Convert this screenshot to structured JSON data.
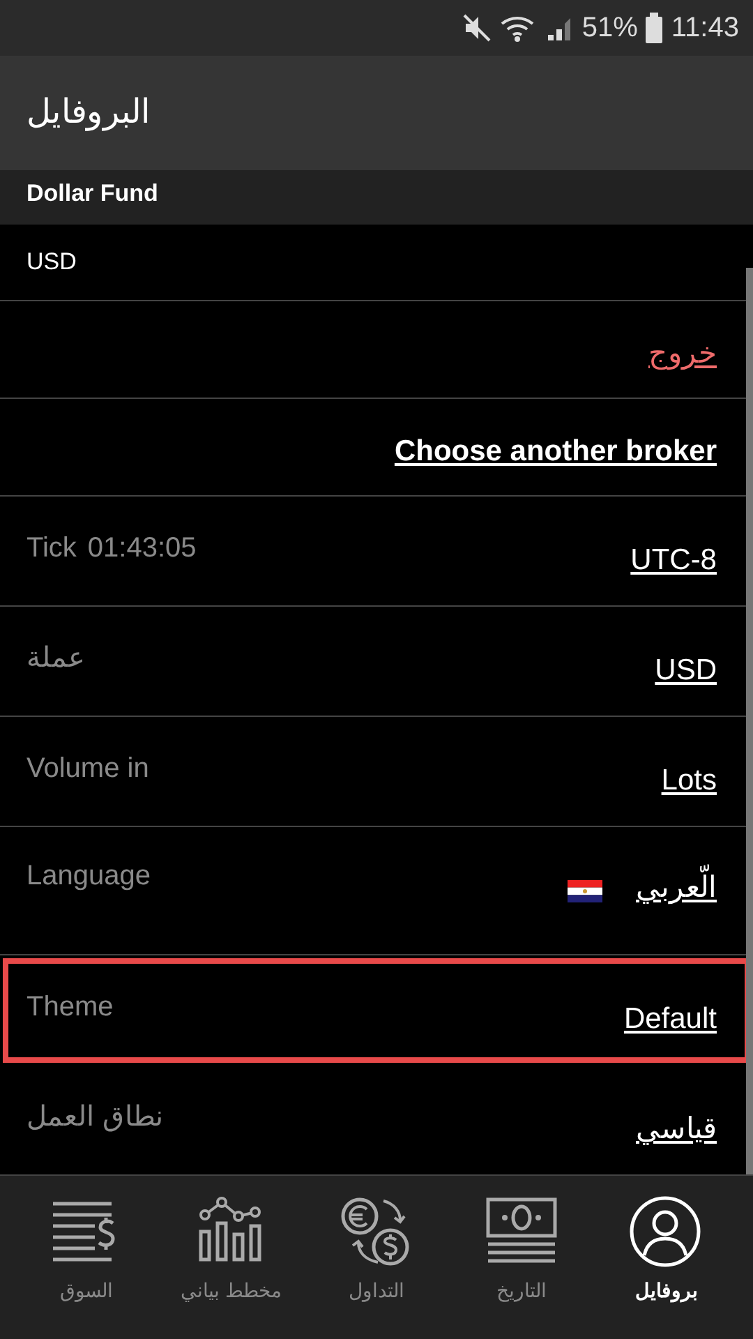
{
  "status_bar": {
    "battery": "51%",
    "time": "11:43"
  },
  "app_bar": {
    "title": "البروفايل"
  },
  "account": {
    "name": "Dollar Fund",
    "currency": "USD"
  },
  "rows": [
    {
      "kind": "link",
      "value": "خروج",
      "danger": true,
      "highlighted": false
    },
    {
      "kind": "link",
      "value": "Choose another broker",
      "bold": true,
      "highlighted": false
    },
    {
      "kind": "setting",
      "label": "Tick",
      "extra": "01:43:05",
      "value": "UTC-8",
      "highlighted": false
    },
    {
      "kind": "setting",
      "label": "عملة",
      "value": "USD",
      "highlighted": false
    },
    {
      "kind": "setting",
      "label": "Volume in",
      "value": "Lots",
      "highlighted": false
    },
    {
      "kind": "setting",
      "label": "Language",
      "value": "الّعربي",
      "flag": true,
      "highlighted": false
    },
    {
      "kind": "setting",
      "label": "Theme",
      "value": "Default",
      "highlighted": true
    },
    {
      "kind": "setting",
      "label": "نطاق العمل",
      "value": "قياسي",
      "highlighted": false
    }
  ],
  "bottom_nav": [
    {
      "label": "بروفايل",
      "selected": true
    },
    {
      "label": "التاريخ",
      "selected": false
    },
    {
      "label": "التداول",
      "selected": false
    },
    {
      "label": "مخطط بياني",
      "selected": false
    },
    {
      "label": "السوق",
      "selected": false
    }
  ]
}
